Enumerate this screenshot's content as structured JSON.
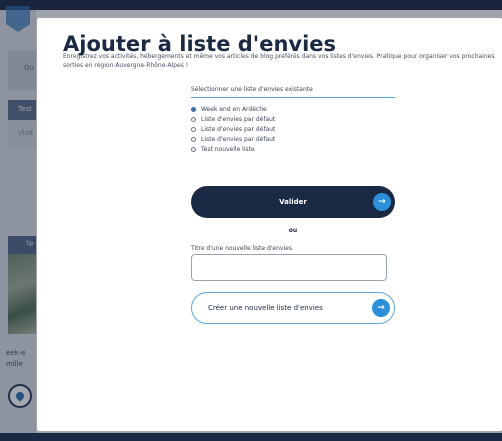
{
  "background": {
    "tab_label": "Ou",
    "row_test_label": "Test",
    "row_visit_label": "Visit",
    "section_label": "Sp",
    "week_label_line1": "eek-e",
    "week_label_line2": "mille"
  },
  "modal": {
    "title": "Ajouter à liste d'envies",
    "description": "Enregistrez vos activités, hébergements et même vos articles de blog préférés dans vos listes d'envies. Pratique pour organiser vos prochaines sorties en région Auvergne-Rhône-Alpes !",
    "select_label": "Sélectionner une liste d'envies existante",
    "lists": [
      {
        "label": "Week end en Ardèche",
        "checked": true
      },
      {
        "label": "Liste d'envies par défaut",
        "checked": false
      },
      {
        "label": "Liste d'envies par défaut",
        "checked": false
      },
      {
        "label": "Liste d'envies par défaut",
        "checked": false
      },
      {
        "label": "Test nouvelle liste",
        "checked": false
      }
    ],
    "validate_label": "Valider",
    "or_label": "ou",
    "new_list_label": "Titre d'une nouvelle liste d'envies",
    "new_list_value": "",
    "create_label": "Créer une nouvelle liste d'envies"
  },
  "colors": {
    "navy": "#1b2a44",
    "accent_blue": "#2b8fd9"
  },
  "icons": {
    "arrow": "arrow-right-icon",
    "logo": "logo-icon",
    "location": "location-pin-icon"
  }
}
